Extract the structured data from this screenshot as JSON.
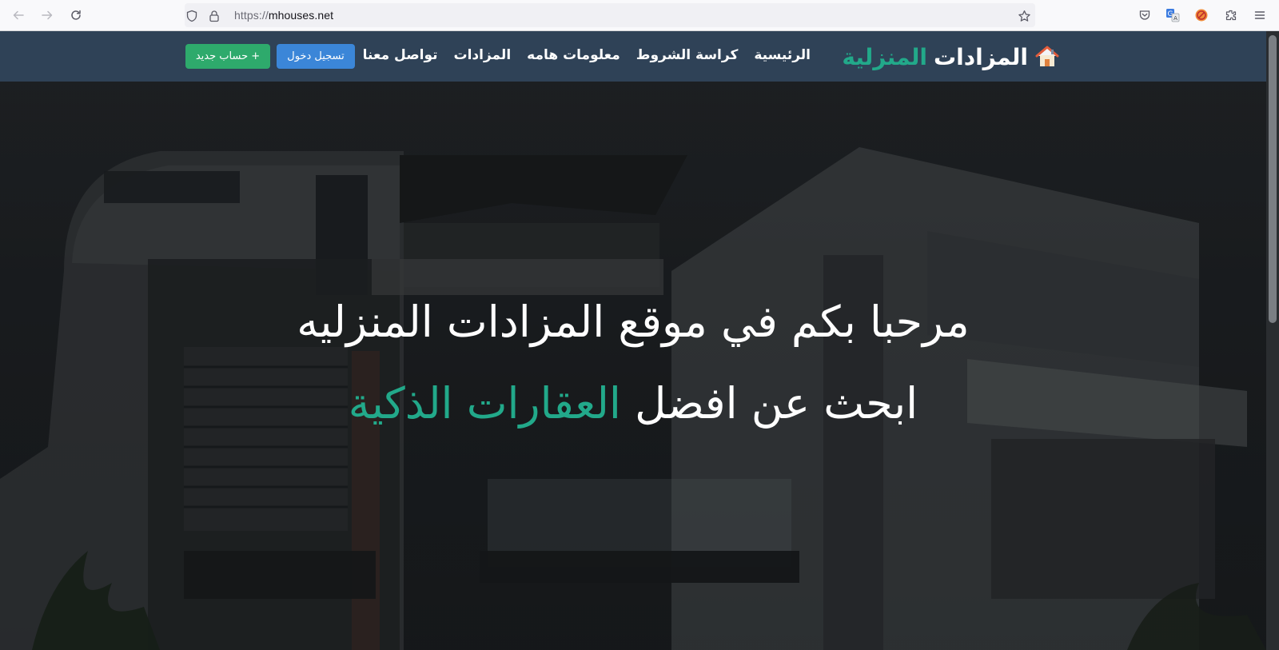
{
  "browser": {
    "url_scheme": "https://",
    "url_host": "mhouses.net"
  },
  "site": {
    "brand_main": "المزادات",
    "brand_accent": "المنزلية",
    "nav_items": [
      "الرئيسية",
      "كراسة الشروط",
      "معلومات هامه",
      "المزادات",
      "تواصل معنا"
    ],
    "login_label": "تسجيل دخول",
    "register_label": "+ حساب جديد"
  },
  "hero": {
    "line1": "مرحبا بكم في موقع المزادات المنزليه",
    "line2_prefix": "ابحث عن افضل",
    "line2_accent": "العقارات الذكية"
  },
  "colors": {
    "navbar": "#2f4257",
    "accent": "#22a98a",
    "login_button": "#3b86d8",
    "register_button": "#2eaa6c"
  }
}
